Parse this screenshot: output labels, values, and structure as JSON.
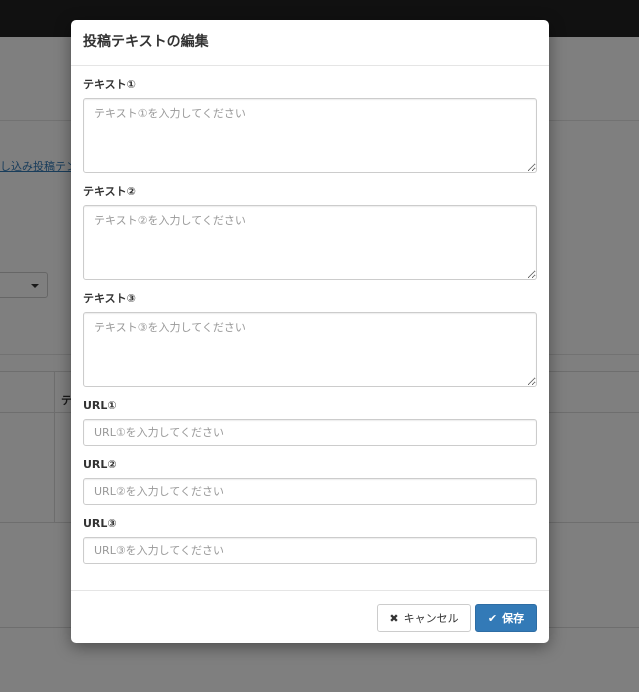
{
  "background": {
    "link_text": "し込み投稿テン",
    "table_header_text": "テ"
  },
  "modal": {
    "title": "投稿テキストの編集",
    "fields": [
      {
        "label": "テキスト①",
        "placeholder": "テキスト①を入力してください",
        "value": ""
      },
      {
        "label": "テキスト②",
        "placeholder": "テキスト②を入力してください",
        "value": ""
      },
      {
        "label": "テキスト③",
        "placeholder": "テキスト③を入力してください",
        "value": ""
      },
      {
        "label": "URL①",
        "placeholder": "URL①を入力してください",
        "value": ""
      },
      {
        "label": "URL②",
        "placeholder": "URL②を入力してください",
        "value": ""
      },
      {
        "label": "URL③",
        "placeholder": "URL③を入力してください",
        "value": ""
      }
    ],
    "footer": {
      "cancel_label": "キャンセル",
      "cancel_icon": "times-icon",
      "save_label": "保存",
      "save_icon": "check-icon"
    }
  },
  "colors": {
    "primary": "#337ab7",
    "topbar": "#222222",
    "backdrop": "rgba(0,0,0,0.5)"
  }
}
